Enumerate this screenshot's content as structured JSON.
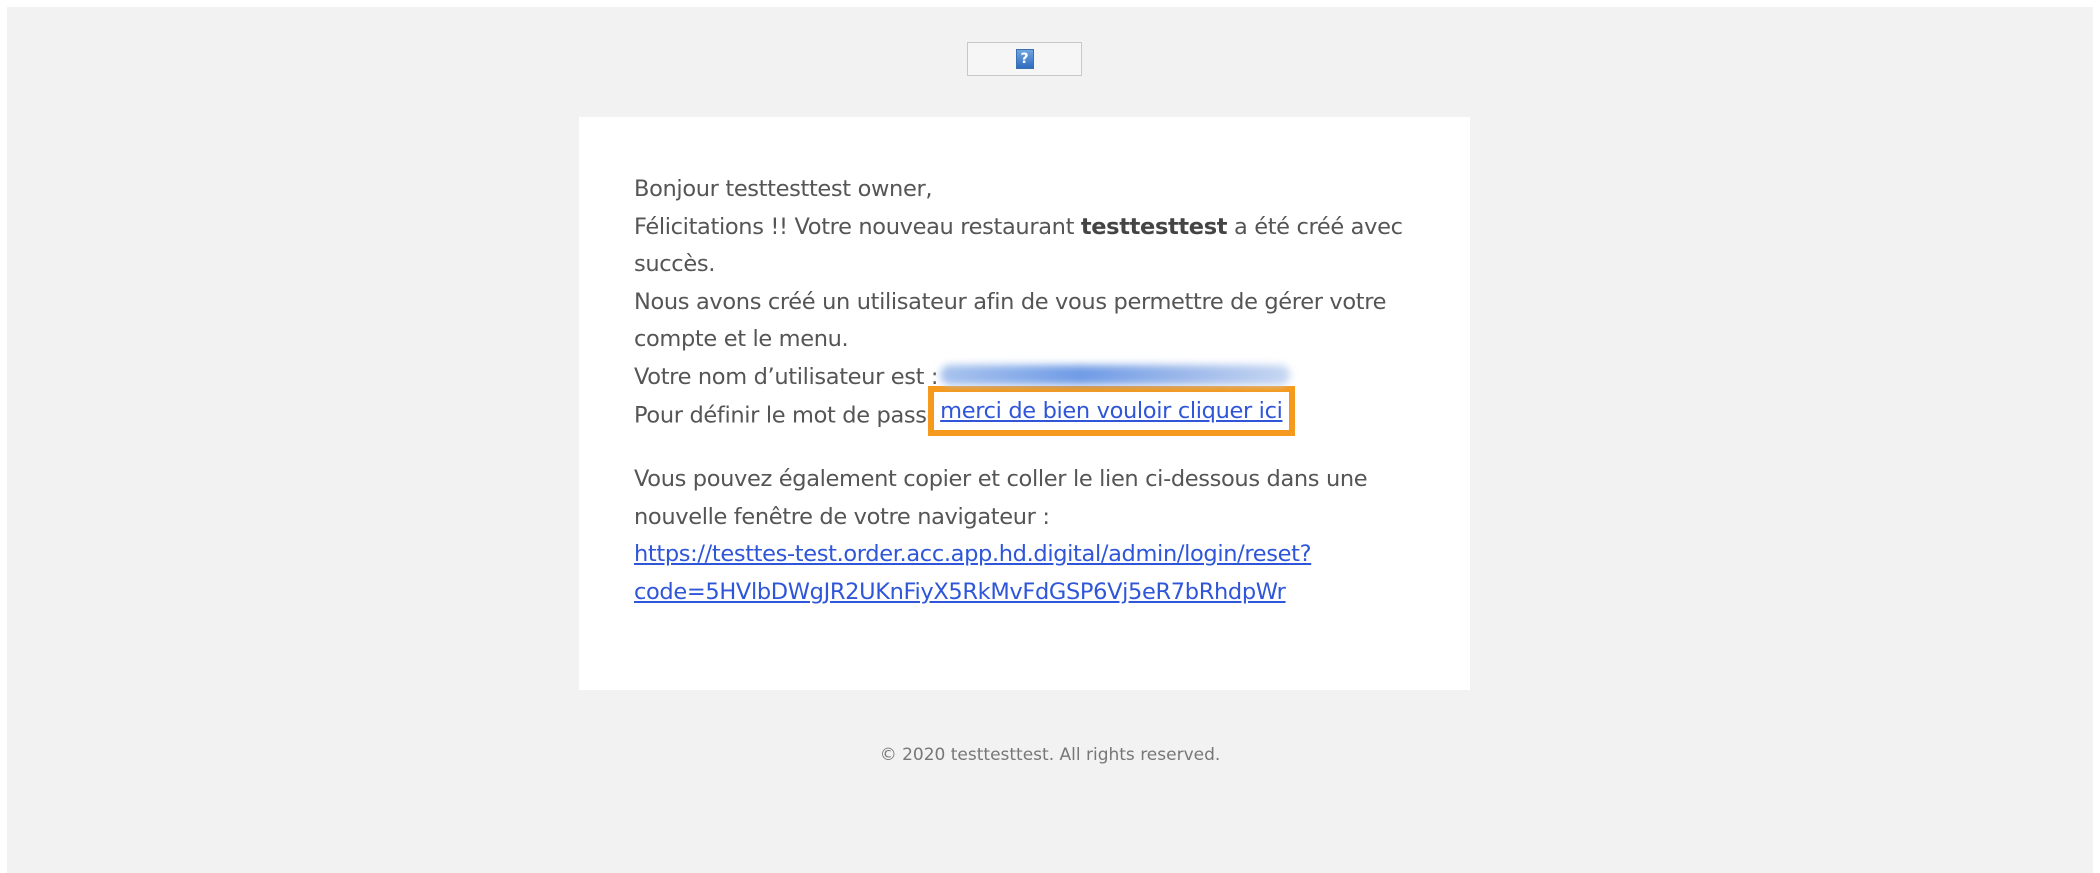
{
  "logo": {
    "icon": "broken-image-icon",
    "glyph": "?"
  },
  "email": {
    "greeting": "Bonjour testtesttest owner,",
    "congrats_prefix": "Félicitations !! Votre nouveau restaurant",
    "restaurant_name": "testtesttest",
    "congrats_suffix": "a été créé avec",
    "congrats_end": "succès.",
    "user_created_line1": "Nous avons créé un utilisateur afin de vous permettre de gérer votre",
    "user_created_line2": "compte et le menu.",
    "username_label": "Votre nom d’utilisateur est :",
    "password_prefix": "Pour définir le mot de passe",
    "password_link": "merci de bien vouloir cliquer ici",
    "copy_line1": "Vous pouvez également copier et coller le lien ci-dessous dans une",
    "copy_line2": "nouvelle fenêtre de votre navigateur :",
    "reset_url_line1": "https://testtes-test.order.acc.app.hd.digital/admin/login/reset?",
    "reset_url_line2": "code=5HVlbDWgJR2UKnFiyX5RkMvFdGSP6Vj5eR7bRhdpWr"
  },
  "footer": {
    "copyright": "© 2020 testtesttest. All rights reserved."
  },
  "colors": {
    "link": "#2f56d8",
    "highlight": "#f59a1c",
    "background": "#f2f2f2"
  }
}
